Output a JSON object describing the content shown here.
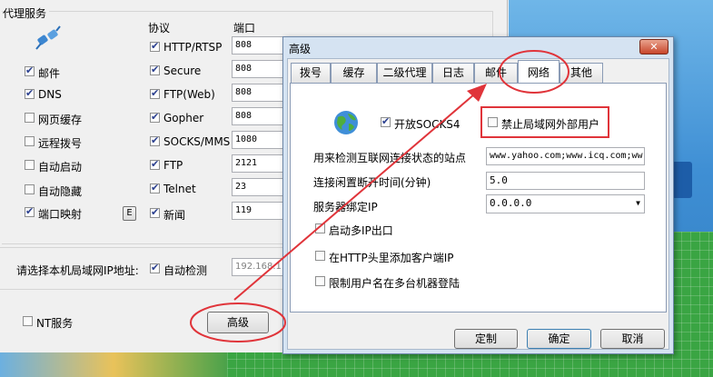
{
  "bg": {
    "title": "代理服务",
    "col_protocol": "协议",
    "col_port": "端口",
    "services": [
      {
        "label": "邮件",
        "checked": true
      },
      {
        "label": "DNS",
        "checked": true
      },
      {
        "label": "网页缓存",
        "checked": false
      },
      {
        "label": "远程拨号",
        "checked": false
      },
      {
        "label": "自动启动",
        "checked": false
      },
      {
        "label": "自动隐藏",
        "checked": false
      },
      {
        "label": "端口映射",
        "checked": true
      }
    ],
    "e_button": "E",
    "protocols": [
      {
        "label": "HTTP/RTSP",
        "port": "808",
        "checked": true
      },
      {
        "label": "Secure",
        "port": "808",
        "checked": true
      },
      {
        "label": "FTP(Web)",
        "port": "808",
        "checked": true
      },
      {
        "label": "Gopher",
        "port": "808",
        "checked": true
      },
      {
        "label": "SOCKS/MMS",
        "port": "1080",
        "checked": true
      },
      {
        "label": "FTP",
        "port": "2121",
        "checked": true
      },
      {
        "label": "Telnet",
        "port": "23",
        "checked": true
      },
      {
        "label": "新闻",
        "port": "119",
        "checked": true
      }
    ],
    "lan_ip_label": "请选择本机局域网IP地址:",
    "auto_detect": "自动检测",
    "ip_value": "192.168.1",
    "nt_service": "NT服务",
    "advanced_button": "高级"
  },
  "dialog": {
    "title": "高级",
    "close": "✕",
    "tabs": [
      "拨号",
      "缓存",
      "二级代理",
      "日志",
      "邮件",
      "网络",
      "其他"
    ],
    "active_tab": "网络",
    "enable_socks": "开放SOCKS4",
    "block_lan_external": "禁止局域网外部用户",
    "detect_site_label": "用来检测互联网连接状态的站点",
    "detect_site_value": "www.yahoo.com;www.icq.com;ww",
    "idle_disconnect_label": "连接闲置断开时间(分钟)",
    "idle_disconnect_value": "5.0",
    "bind_ip_label": "服务器绑定IP",
    "bind_ip_value": "0.0.0.0",
    "multi_ip": "启动多IP出口",
    "add_client_ip": "在HTTP头里添加客户端IP",
    "limit_user": "限制用户名在多台机器登陆",
    "customize": "定制",
    "ok": "确定",
    "cancel": "取消"
  },
  "colors": {
    "annotation": "#e0343a",
    "dialog_title_bg": "#cfe0f3",
    "green_bg": "#3aa543"
  }
}
